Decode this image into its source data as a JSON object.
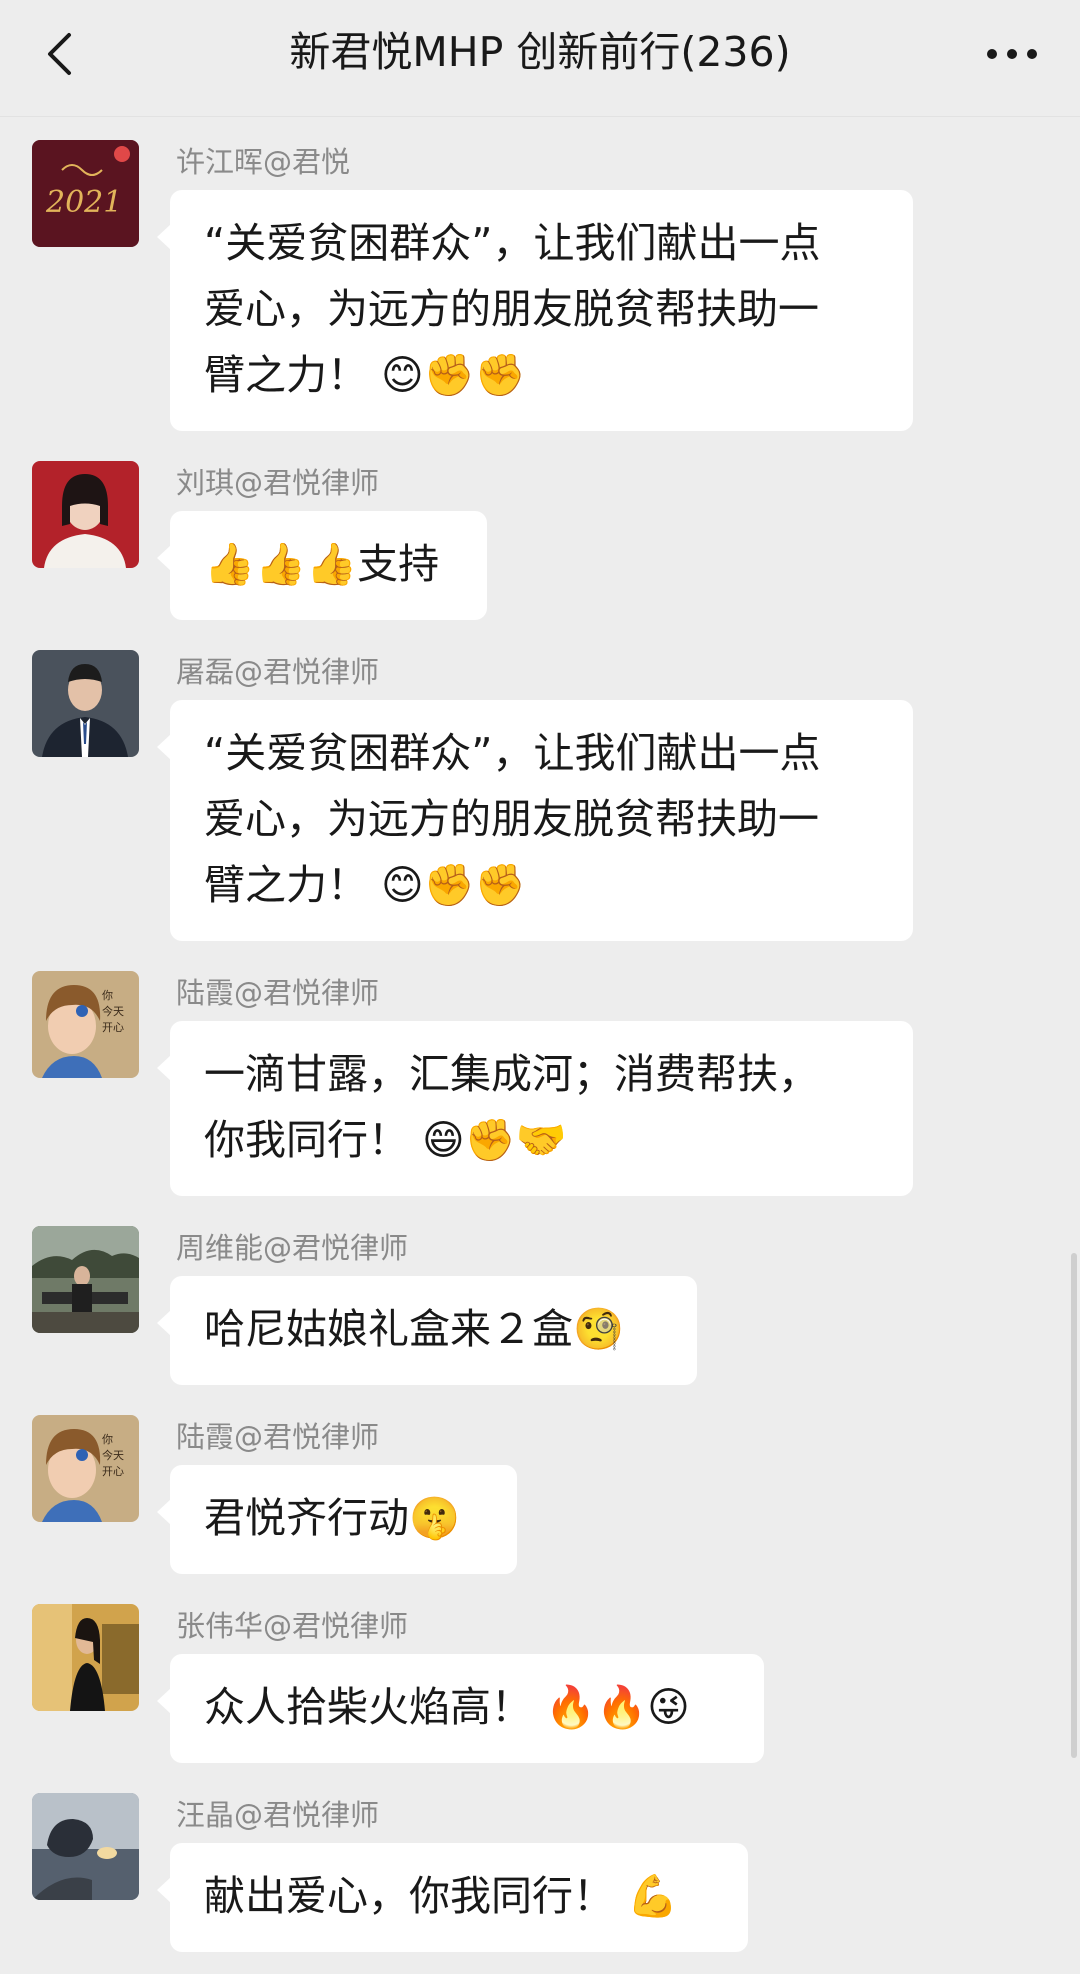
{
  "header": {
    "title": "新君悦MHP 创新前行(236)"
  },
  "messages": [
    {
      "sender": "许江晖@君悦",
      "text": "“关爱贫困群众”，让我们献出一点\n爱心，为远方的朋友脱贫帮扶助一\n臂之力！ 😊✊✊",
      "avatar_color": "#7a1d2a"
    },
    {
      "sender": "刘琪@君悦律师",
      "text": "👍👍👍支持",
      "avatar_color": "#b0262c"
    },
    {
      "sender": "屠磊@君悦律师",
      "text": "“关爱贫困群众”，让我们献出一点\n爱心，为远方的朋友脱贫帮扶助一\n臂之力！ 😊✊✊",
      "avatar_color": "#3c4450"
    },
    {
      "sender": "陆霞@君悦律师",
      "text": "一滴甘露，汇集成河；消费帮扶，\n你我同行！ 😄✊🤝",
      "avatar_color": "#b89968"
    },
    {
      "sender": "周维能@君悦律师",
      "text": "哈尼姑娘礼盒来２盒🧐",
      "avatar_color": "#5f6b57"
    },
    {
      "sender": "陆霞@君悦律师",
      "text": "君悦齐行动🤫",
      "avatar_color": "#b89968"
    },
    {
      "sender": "张伟华@君悦律师",
      "text": "众人拾柴火焰高！ 🔥🔥😜",
      "avatar_color": "#c9a04a"
    },
    {
      "sender": "汪晶@君悦律师",
      "text": "献出爱心，你我同行！ 💪",
      "avatar_color": "#4f5a6a"
    }
  ]
}
